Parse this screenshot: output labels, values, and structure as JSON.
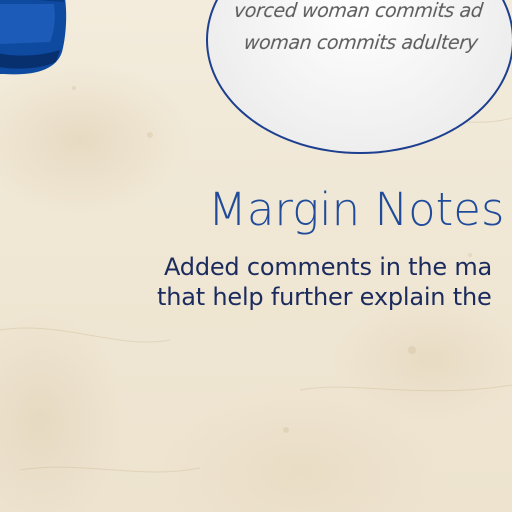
{
  "magnifier": {
    "lines": [
      "vorced woman commits ad",
      "woman commits adultery"
    ]
  },
  "section": {
    "title": "Margin Notes",
    "description_lines": [
      "Added comments in the ma",
      "that help further explain the"
    ]
  },
  "colors": {
    "paper": "#f1e9d8",
    "title": "#1f4b9a",
    "text": "#1b2b5e",
    "ring": "#1d3f8f",
    "ink": "#0d4aa0"
  },
  "icons": {
    "corner_decoration": "ink-blot-icon"
  }
}
